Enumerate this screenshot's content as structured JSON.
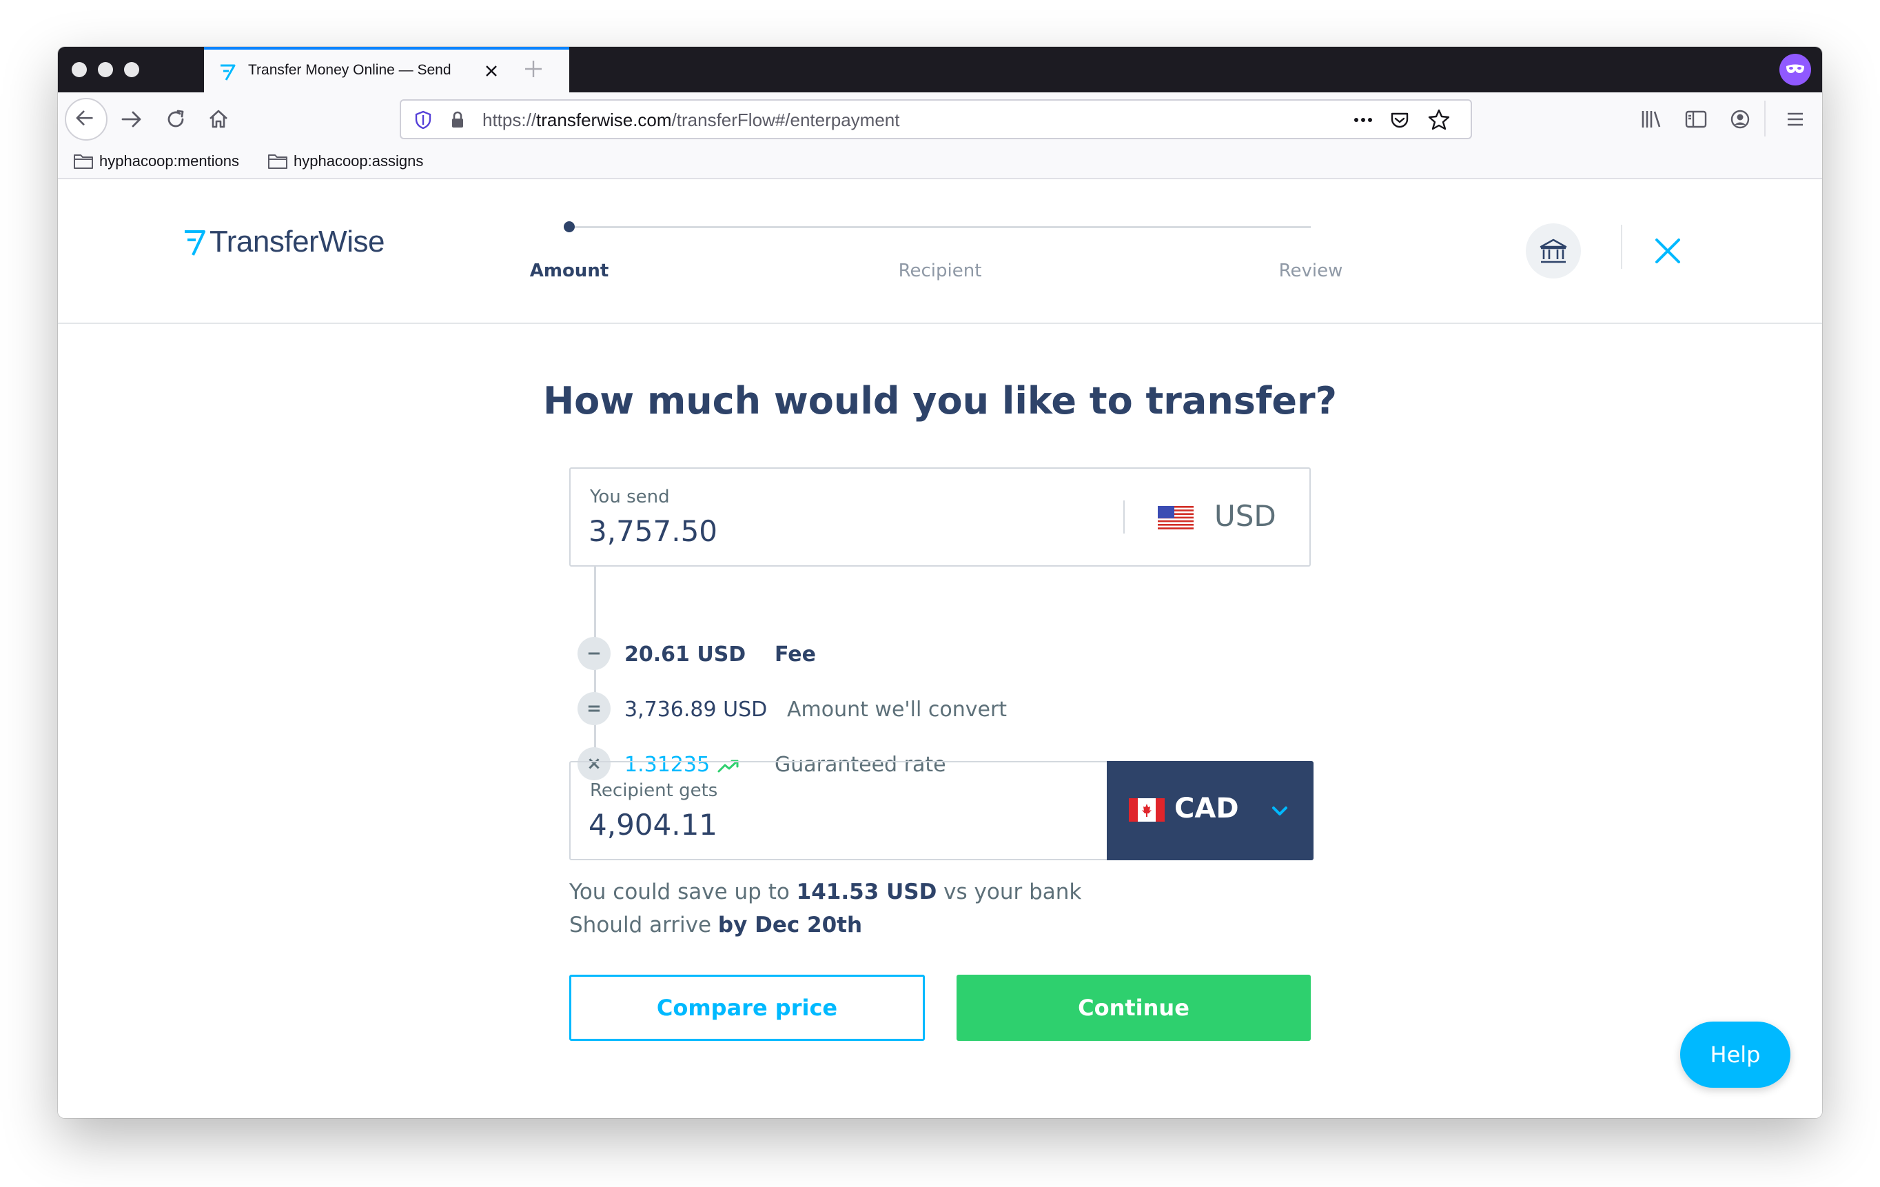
{
  "browser": {
    "tab_title": "Transfer Money Online — Send",
    "url_prefix": "https://",
    "url_domain": "transferwise.com",
    "url_path": "/transferFlow#/enterpayment",
    "bookmarks": [
      "hyphacoop:mentions",
      "hyphacoop:assigns"
    ]
  },
  "header": {
    "logo_text": "TransferWise",
    "steps": [
      "Amount",
      "Recipient",
      "Review"
    ],
    "active_step": "Amount"
  },
  "main": {
    "title": "How much would you like to transfer?",
    "send": {
      "label": "You send",
      "amount": "3,757.50",
      "currency": "USD"
    },
    "breakdown": {
      "fee_symbol": "−",
      "fee_amount": "20.61 USD",
      "fee_label": "Fee",
      "convert_symbol": "=",
      "convert_amount": "3,736.89 USD",
      "convert_label": "Amount we'll convert",
      "rate_symbol": "×",
      "rate_value": "1.31235",
      "rate_label": "Guaranteed rate"
    },
    "receive": {
      "label": "Recipient gets",
      "amount": "4,904.11",
      "currency": "CAD"
    },
    "savings": {
      "prefix": "You could save up to ",
      "amount": "141.53 USD",
      "suffix": " vs your bank"
    },
    "arrival": {
      "prefix": "Should arrive ",
      "date": "by Dec 20th"
    },
    "buttons": {
      "compare": "Compare price",
      "continue": "Continue",
      "help": "Help"
    }
  },
  "colors": {
    "brand_navy": "#2e4369",
    "accent_blue": "#00b9ff",
    "continue_green": "#2ed06e",
    "tab_accent": "#0a84ff"
  },
  "icons": [
    "back-arrow-icon",
    "forward-arrow-icon",
    "reload-icon",
    "home-icon",
    "shield-icon",
    "lock-icon",
    "more-icon",
    "pocket-icon",
    "star-icon",
    "library-icon",
    "sidebar-icon",
    "account-icon",
    "menu-icon",
    "folder-icon",
    "bank-icon",
    "close-icon",
    "trend-up-icon",
    "chevron-down-icon",
    "us-flag-icon",
    "canada-flag-icon"
  ]
}
